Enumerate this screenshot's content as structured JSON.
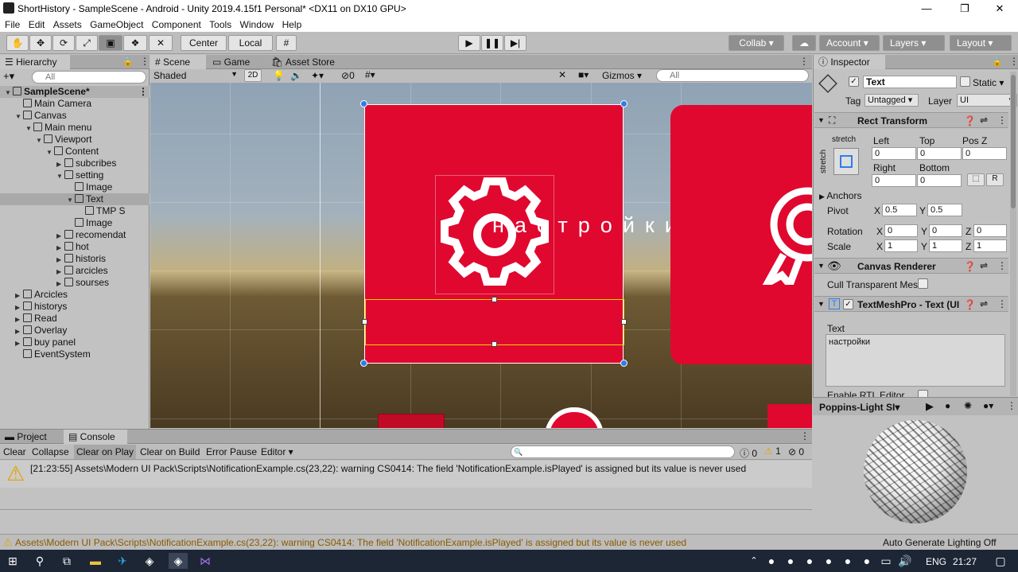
{
  "titlebar": {
    "title": "ShortHistory - SampleScene - Android - Unity 2019.4.15f1 Personal* <DX11 on DX10 GPU>",
    "minimize": "—",
    "maximize": "❐",
    "close": "✕"
  },
  "menu": [
    "File",
    "Edit",
    "Assets",
    "GameObject",
    "Component",
    "Tools",
    "Window",
    "Help"
  ],
  "toolbar": {
    "center": "Center",
    "local": "Local",
    "collab": "Collab ▾",
    "account": "Account",
    "layers": "Layers",
    "layout": "Layout"
  },
  "hierarchy": {
    "tab": "Hierarchy",
    "create": "+▾",
    "search_placeholder": "All",
    "items": [
      {
        "label": "SampleScene*",
        "depth": 0,
        "arrow": "▼",
        "scene": true
      },
      {
        "label": "Main Camera",
        "depth": 1,
        "arrow": ""
      },
      {
        "label": "Canvas",
        "depth": 1,
        "arrow": "▼"
      },
      {
        "label": "Main menu",
        "depth": 2,
        "arrow": "▼"
      },
      {
        "label": "Viewport",
        "depth": 3,
        "arrow": "▼"
      },
      {
        "label": "Content",
        "depth": 4,
        "arrow": "▼"
      },
      {
        "label": "subcribes",
        "depth": 5,
        "arrow": "▶"
      },
      {
        "label": "setting",
        "depth": 5,
        "arrow": "▼"
      },
      {
        "label": "Image",
        "depth": 6,
        "arrow": ""
      },
      {
        "label": "Text",
        "depth": 6,
        "arrow": "▼",
        "selected": true
      },
      {
        "label": "TMP S",
        "depth": 7,
        "arrow": ""
      },
      {
        "label": "Image",
        "depth": 6,
        "arrow": ""
      },
      {
        "label": "recomendat",
        "depth": 5,
        "arrow": "▶"
      },
      {
        "label": "hot",
        "depth": 5,
        "arrow": "▶"
      },
      {
        "label": "historis",
        "depth": 5,
        "arrow": "▶"
      },
      {
        "label": "arcicles",
        "depth": 5,
        "arrow": "▶"
      },
      {
        "label": "sourses",
        "depth": 5,
        "arrow": "▶"
      },
      {
        "label": "Arcicles",
        "depth": 1,
        "arrow": "▶"
      },
      {
        "label": "historys",
        "depth": 1,
        "arrow": "▶"
      },
      {
        "label": "Read",
        "depth": 1,
        "arrow": "▶"
      },
      {
        "label": "Overlay",
        "depth": 1,
        "arrow": "▶"
      },
      {
        "label": "buy panel",
        "depth": 1,
        "arrow": "▶"
      },
      {
        "label": "EventSystem",
        "depth": 1,
        "arrow": ""
      }
    ]
  },
  "scene": {
    "tabs": [
      "Scene",
      "Game",
      "Asset Store"
    ],
    "shading": "Shaded",
    "mode2d": "2D",
    "fx_count": "0",
    "gizmos": "Gizmos",
    "search_placeholder": "All",
    "card_text": "настройки",
    "accent": "#e0002d"
  },
  "inspector": {
    "tab": "Inspector",
    "object_name": "Text",
    "static_label": "Static",
    "tag_label": "Tag",
    "tag_value": "Untagged",
    "layer_label": "Layer",
    "layer_value": "UI",
    "rect_transform": {
      "title": "Rect Transform",
      "anchor_label": "stretch",
      "left_label": "Left",
      "left": "0",
      "top_label": "Top",
      "top": "0",
      "posz_label": "Pos Z",
      "posz": "0",
      "right_label": "Right",
      "right": "0",
      "bottom_label": "Bottom",
      "bottom": "0",
      "anchors_label": "Anchors",
      "pivot_label": "Pivot",
      "pivot_x": "0.5",
      "pivot_y": "0.5",
      "rotation_label": "Rotation",
      "rot_x": "0",
      "rot_y": "0",
      "rot_z": "0",
      "scale_label": "Scale",
      "scale_x": "1",
      "scale_y": "1",
      "scale_z": "1"
    },
    "canvas_renderer": {
      "title": "Canvas Renderer",
      "cull_label": "Cull Transparent Mes"
    },
    "tmp": {
      "title": "TextMeshPro - Text (UI",
      "text_label": "Text",
      "text_value": "настройки",
      "rtl_label": "Enable RTL Editor"
    },
    "preview": {
      "font_name": "Poppins-Light SI▾"
    }
  },
  "bottom": {
    "tabs": [
      "Project",
      "Console"
    ],
    "buttons": [
      "Clear",
      "Collapse",
      "Clear on Play",
      "Clear on Build",
      "Error Pause",
      "Editor ▾"
    ],
    "counts": {
      "info": "0",
      "warn": "1",
      "error": "0"
    },
    "log_message": "[21:23:55] Assets\\Modern UI Pack\\Scripts\\NotificationExample.cs(23,22): warning CS0414: The field 'NotificationExample.isPlayed' is assigned but its value is never used"
  },
  "statusbar": {
    "message": "Assets\\Modern UI Pack\\Scripts\\NotificationExample.cs(23,22): warning CS0414: The field 'NotificationExample.isPlayed' is assigned but its value is never used",
    "lighting": "Auto Generate Lighting Off"
  },
  "taskbar": {
    "lang": "ENG",
    "time": "21:27"
  }
}
